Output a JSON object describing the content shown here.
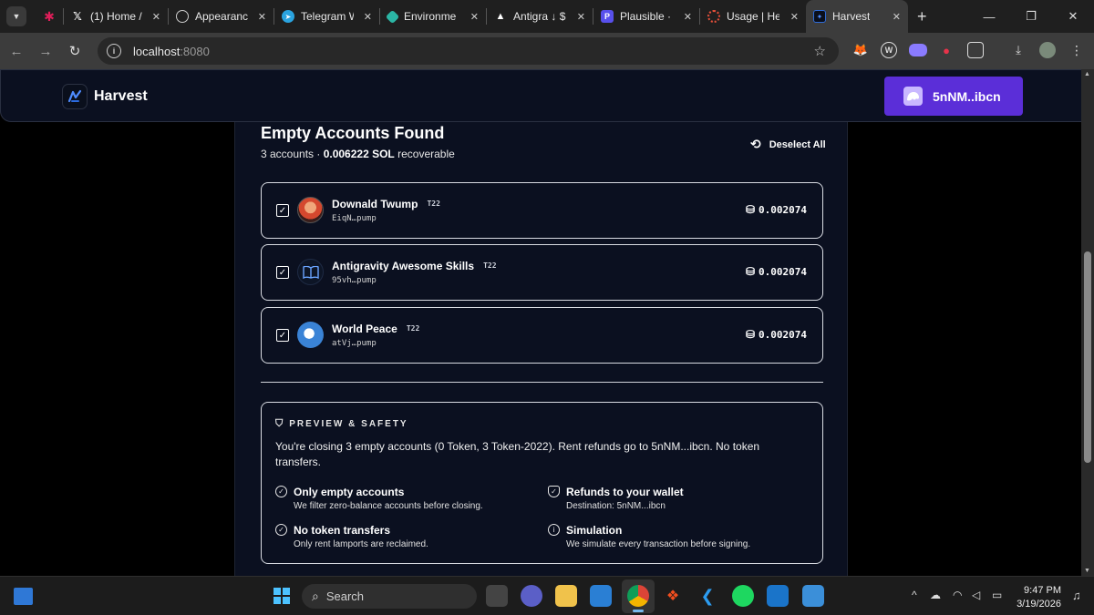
{
  "browser": {
    "tabs": [
      {
        "label": "",
        "icon": "slack-icon"
      },
      {
        "label": "(1) Home /",
        "icon": "x-icon"
      },
      {
        "label": "Appearance",
        "icon": "github-icon"
      },
      {
        "label": "Telegram W",
        "icon": "telegram-icon"
      },
      {
        "label": "Environmen",
        "icon": "render-icon"
      },
      {
        "label": "Antigra ↓ $",
        "icon": "antigravity-icon"
      },
      {
        "label": "Plausible ·",
        "icon": "plausible-icon"
      },
      {
        "label": "Usage | Hel",
        "icon": "helius-icon"
      },
      {
        "label": "Harvest",
        "icon": "harvest-icon"
      }
    ],
    "url_host": "localhost",
    "url_port": ":8080"
  },
  "app": {
    "brand": "Harvest",
    "wallet_label": "5nNM..ibcn"
  },
  "results": {
    "title": "Empty Accounts Found",
    "count_text": "3 accounts · ",
    "amount_text": "0.006222 SOL",
    "recoverable_text": " recoverable",
    "deselect_label": "Deselect All"
  },
  "accounts": [
    {
      "name": "Downald Twump",
      "tag": "T22",
      "address": "EiqN…pump",
      "amount": "0.002074",
      "checked": true
    },
    {
      "name": "Antigravity Awesome Skills",
      "tag": "T22",
      "address": "95vh…pump",
      "amount": "0.002074",
      "checked": true
    },
    {
      "name": "World Peace",
      "tag": "T22",
      "address": "atVj…pump",
      "amount": "0.002074",
      "checked": true
    }
  ],
  "safety": {
    "heading": "PREVIEW & SAFETY",
    "description": "You're closing 3 empty accounts (0 Token, 3 Token-2022). Rent refunds go to 5nNM...ibcn. No token transfers.",
    "features": [
      {
        "title": "Only empty accounts",
        "desc": "We filter zero-balance accounts before closing.",
        "icon": "check-circle-icon"
      },
      {
        "title": "Refunds to your wallet",
        "desc": "Destination: 5nNM...ibcn",
        "icon": "shield-check-icon"
      },
      {
        "title": "No token transfers",
        "desc": "Only rent lamports are reclaimed.",
        "icon": "check-circle-icon"
      },
      {
        "title": "Simulation",
        "desc": "We simulate every transaction before signing.",
        "icon": "info-icon"
      }
    ]
  },
  "taskbar": {
    "search_label": "Search",
    "time": "9:47 PM",
    "date": "3/19/2026"
  }
}
